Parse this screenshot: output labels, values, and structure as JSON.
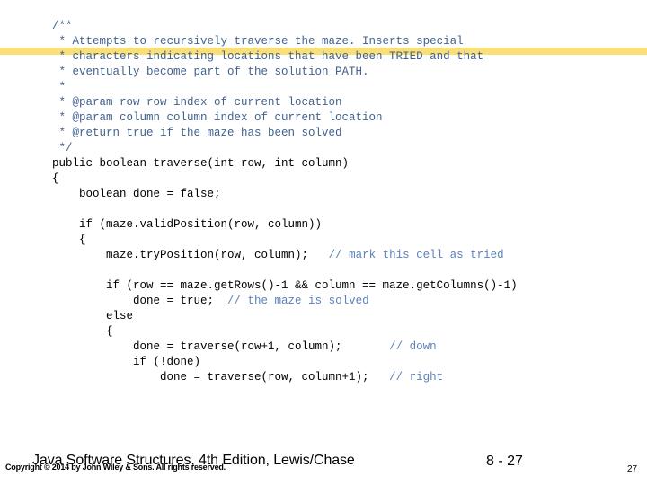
{
  "slide": {
    "highlight_band_color": "#f9df76",
    "comment_color": "#41628f",
    "inline_comment_color": "#5b82bd",
    "code_color": "#000000",
    "background_color": "#ffffff"
  },
  "code": {
    "language": "java",
    "lines": [
      {
        "indent": 0,
        "segments": [
          {
            "type": "comment",
            "text": "/**"
          }
        ]
      },
      {
        "indent": 0,
        "segments": [
          {
            "type": "comment",
            "text": " * Attempts to recursively traverse the maze. Inserts special"
          }
        ]
      },
      {
        "indent": 0,
        "segments": [
          {
            "type": "comment",
            "text": " * characters indicating locations that have been TRIED and that"
          }
        ]
      },
      {
        "indent": 0,
        "segments": [
          {
            "type": "comment",
            "text": " * eventually become part of the solution PATH."
          }
        ]
      },
      {
        "indent": 0,
        "segments": [
          {
            "type": "comment",
            "text": " *"
          }
        ]
      },
      {
        "indent": 0,
        "segments": [
          {
            "type": "comment",
            "text": " * @param row row index of current location"
          }
        ]
      },
      {
        "indent": 0,
        "segments": [
          {
            "type": "comment",
            "text": " * @param column column index of current location"
          }
        ]
      },
      {
        "indent": 0,
        "segments": [
          {
            "type": "comment",
            "text": " * @return true if the maze has been solved"
          }
        ]
      },
      {
        "indent": 0,
        "segments": [
          {
            "type": "comment",
            "text": " */"
          }
        ]
      },
      {
        "indent": 0,
        "segments": [
          {
            "type": "code",
            "text": "public boolean traverse(int row, int column)"
          }
        ]
      },
      {
        "indent": 0,
        "segments": [
          {
            "type": "code",
            "text": "{"
          }
        ]
      },
      {
        "indent": 0,
        "segments": [
          {
            "type": "code",
            "text": "    boolean done = false;"
          }
        ]
      },
      {
        "indent": 0,
        "segments": [
          {
            "type": "code",
            "text": ""
          }
        ]
      },
      {
        "indent": 0,
        "segments": [
          {
            "type": "code",
            "text": "    if (maze.validPosition(row, column))"
          }
        ]
      },
      {
        "indent": 0,
        "segments": [
          {
            "type": "code",
            "text": "    {"
          }
        ]
      },
      {
        "indent": 0,
        "segments": [
          {
            "type": "code",
            "text": "        maze.tryPosition(row, column);   "
          },
          {
            "type": "inline-comment",
            "text": "// mark this cell as tried"
          }
        ]
      },
      {
        "indent": 0,
        "segments": [
          {
            "type": "code",
            "text": ""
          }
        ]
      },
      {
        "indent": 0,
        "segments": [
          {
            "type": "code",
            "text": "        if (row == maze.getRows()-1 && column == maze.getColumns()-1)"
          }
        ]
      },
      {
        "indent": 0,
        "segments": [
          {
            "type": "code",
            "text": "            done = true;  "
          },
          {
            "type": "inline-comment",
            "text": "// the maze is solved"
          }
        ]
      },
      {
        "indent": 0,
        "segments": [
          {
            "type": "code",
            "text": "        else"
          }
        ]
      },
      {
        "indent": 0,
        "segments": [
          {
            "type": "code",
            "text": "        {"
          }
        ]
      },
      {
        "indent": 0,
        "segments": [
          {
            "type": "code",
            "text": "            done = traverse(row+1, column);       "
          },
          {
            "type": "inline-comment",
            "text": "// down"
          }
        ]
      },
      {
        "indent": 0,
        "segments": [
          {
            "type": "code",
            "text": "            if (!done)"
          }
        ]
      },
      {
        "indent": 0,
        "segments": [
          {
            "type": "code",
            "text": "                done = traverse(row, column+1);   "
          },
          {
            "type": "inline-comment",
            "text": "// right"
          }
        ]
      }
    ]
  },
  "footer": {
    "copyright": "Copyright © 2014 by John Wiley & Sons. All rights reserved.",
    "book_title": "Java Software Structures, 4th Edition, Lewis/Chase",
    "section_number": "8 - 27",
    "page_number": "27"
  }
}
